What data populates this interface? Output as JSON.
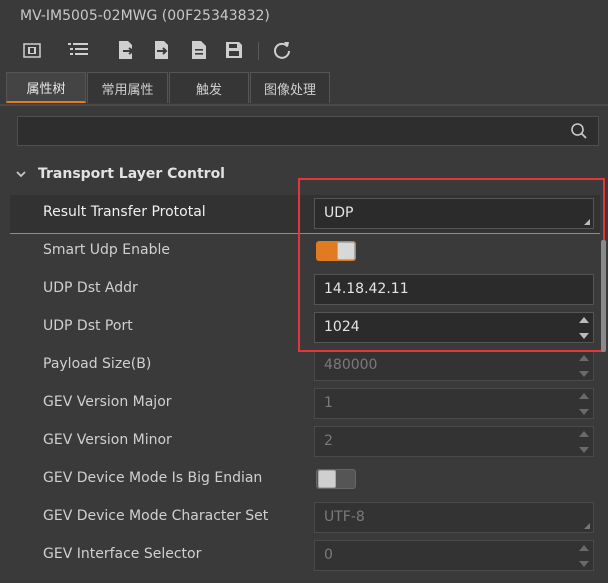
{
  "window": {
    "title": "MV-IM5005-02MWG (00F25343832)"
  },
  "toolbar": {
    "icons": [
      "device-icon",
      "list-icon",
      "import-icon",
      "export-icon",
      "file-icon",
      "save-icon",
      "refresh-icon"
    ]
  },
  "tabs": [
    {
      "label": "属性树",
      "active": true
    },
    {
      "label": "常用属性",
      "active": false
    },
    {
      "label": "触发",
      "active": false
    },
    {
      "label": "图像处理",
      "active": false
    }
  ],
  "search": {
    "placeholder": ""
  },
  "section": {
    "label": "Transport Layer Control",
    "expanded": true
  },
  "properties": [
    {
      "name": "Result Transfer Prototal",
      "type": "dropdown",
      "value": "UDP",
      "enabled": true,
      "selected": true
    },
    {
      "name": "Smart Udp Enable",
      "type": "toggle",
      "value": "on",
      "enabled": true
    },
    {
      "name": "UDP Dst Addr",
      "type": "text",
      "value": "14.18.42.11",
      "enabled": true
    },
    {
      "name": "UDP Dst Port",
      "type": "spin",
      "value": "1024",
      "enabled": true
    },
    {
      "name": "Payload Size(B)",
      "type": "spin",
      "value": "480000",
      "enabled": false
    },
    {
      "name": "GEV Version Major",
      "type": "spin",
      "value": "1",
      "enabled": false
    },
    {
      "name": "GEV Version Minor",
      "type": "spin",
      "value": "2",
      "enabled": false
    },
    {
      "name": "GEV Device Mode Is Big Endian",
      "type": "toggle",
      "value": "off",
      "enabled": false
    },
    {
      "name": "GEV Device Mode Character Set",
      "type": "dropdown",
      "value": "UTF-8",
      "enabled": false
    },
    {
      "name": "GEV Interface Selector",
      "type": "spin",
      "value": "0",
      "enabled": false
    }
  ],
  "colors": {
    "accent": "#e07b22",
    "highlight_box": "#e5353a",
    "background": "#3a3a3a"
  }
}
